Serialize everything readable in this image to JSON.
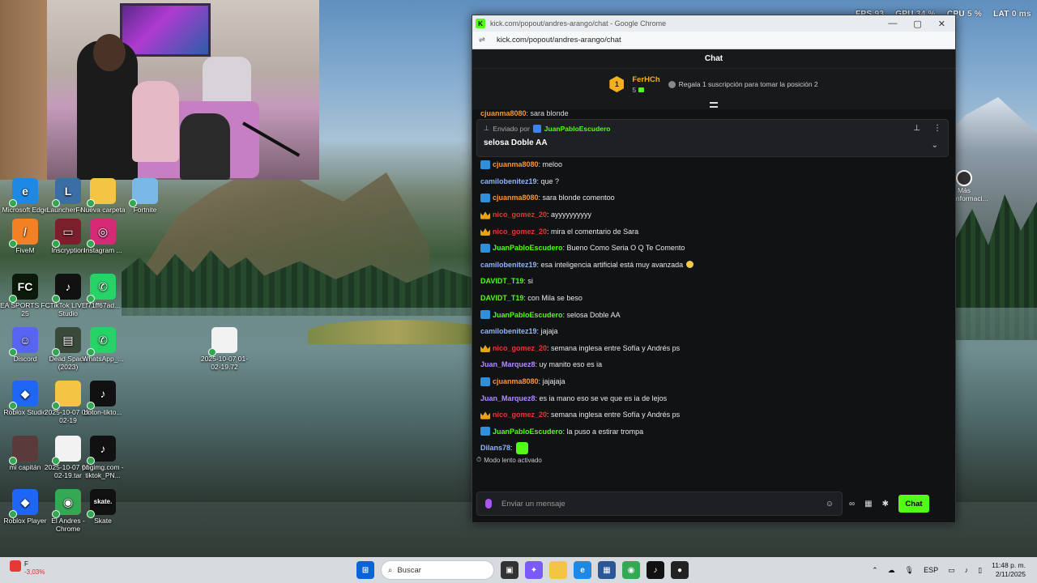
{
  "hud": {
    "fps_label": "FPS",
    "fps_value": "93",
    "gpu_label": "GPU",
    "gpu_value": "34 %",
    "cpu_label": "CPU",
    "cpu_value": "5 %",
    "lat_label": "LAT",
    "lat_value": "0 ms"
  },
  "desktop_icons": [
    {
      "label": "Microsoft Edge",
      "color": "#1e88e5",
      "glyph": "e"
    },
    {
      "label": "LauncherFe...",
      "color": "#3b6ea5",
      "glyph": "L"
    },
    {
      "label": "Nueva carpeta",
      "color": "#f4c542",
      "glyph": ""
    },
    {
      "label": "Fortnite",
      "color": "#7ab8e8",
      "glyph": ""
    },
    {
      "label": "FiveM",
      "color": "#f48024",
      "glyph": "/"
    },
    {
      "label": "Inscryption",
      "color": "#7a1f2b",
      "glyph": "▭"
    },
    {
      "label": "Instagram ...",
      "color": "#d62976",
      "glyph": "◎"
    },
    {
      "label": "EA SPORTS FC 25",
      "color": "#0b1a0b",
      "glyph": "FC"
    },
    {
      "label": "TikTok LIVE Studio",
      "color": "#111111",
      "glyph": "♪"
    },
    {
      "label": "f71ff67ad...",
      "color": "#25d366",
      "glyph": "✆"
    },
    {
      "label": "Discord",
      "color": "#5865f2",
      "glyph": "☺"
    },
    {
      "label": "Dead Space (2023)",
      "color": "#3a4a3a",
      "glyph": "▤"
    },
    {
      "label": "WhatsApp_...",
      "color": "#25d366",
      "glyph": "✆"
    },
    {
      "label": "2025-10-07 01-02-19.72",
      "color": "#f2f2f2",
      "glyph": ""
    },
    {
      "label": "Roblox Studio",
      "color": "#1e66f5",
      "glyph": "◆"
    },
    {
      "label": "2025-10-07 01-02-19",
      "color": "#f4c542",
      "glyph": ""
    },
    {
      "label": "boton-tikto...",
      "color": "#111111",
      "glyph": "♪"
    },
    {
      "label": "mi capitán",
      "color": "#5a3a3a",
      "glyph": ""
    },
    {
      "label": "2025-10-07 01-02-19.tar",
      "color": "#f2f2f2",
      "glyph": ""
    },
    {
      "label": "pngimg.com - tiktok_PN...",
      "color": "#111111",
      "glyph": "♪"
    },
    {
      "label": "Roblox Player",
      "color": "#1e66f5",
      "glyph": "◆"
    },
    {
      "label": "El Andres - Chrome",
      "color": "#34a853",
      "glyph": "◉"
    },
    {
      "label": "Skate",
      "color": "#111111",
      "glyph": "skate."
    }
  ],
  "right_icon": {
    "label": "Más informaci..."
  },
  "browser": {
    "title": "kick.com/popout/andres-arango/chat - Google Chrome",
    "url": "kick.com/popout/andres-arango/chat",
    "favicon": "K",
    "minimize": "—",
    "maximize": "▢",
    "close": "✕"
  },
  "chat": {
    "header": "Chat",
    "leader": {
      "rank": "1",
      "name": "FerHCh",
      "count": "5",
      "cta": "Regala 1 suscripción para tomar la posición 2"
    },
    "cut_user": "cjuanma8080",
    "cut_text": ": sara blonde",
    "pinned": {
      "prefix": "Enviado por",
      "user": "JuanPabloEscudero",
      "message": "selosa Doble AA",
      "pin_icon": "📌",
      "more_icon": "⋮",
      "expand_icon": "⌄"
    },
    "messages": [
      {
        "badge": "mod",
        "user": "cjuanma8080",
        "color": "#f49739",
        "text": ": meloo",
        "emote": ""
      },
      {
        "badge": "",
        "user": "camilobenitez19",
        "color": "#8fb4ff",
        "text": ": que ?",
        "emote": ""
      },
      {
        "badge": "mod",
        "user": "cjuanma8080",
        "color": "#f49739",
        "text": ": sara blonde comentoo",
        "emote": ""
      },
      {
        "badge": "crown",
        "user": "nico_gomez_20",
        "color": "#e53935",
        "text": ": ayyyyyyyyyy",
        "emote": ""
      },
      {
        "badge": "crown",
        "user": "nico_gomez_20",
        "color": "#e53935",
        "text": ": mira el comentario de Sara",
        "emote": ""
      },
      {
        "badge": "mod",
        "user": "JuanPabloEscudero",
        "color": "#53fc18",
        "text": ": Bueno Como Seria O Q Te Comento",
        "emote": ""
      },
      {
        "badge": "",
        "user": "camilobenitez19",
        "color": "#8fb4ff",
        "text": ": esa inteligencia artificial está muy avanzada",
        "emote": "sm"
      },
      {
        "badge": "",
        "user": "DAVIDT_T19",
        "color": "#53fc18",
        "text": ": si",
        "emote": ""
      },
      {
        "badge": "",
        "user": "DAVIDT_T19",
        "color": "#53fc18",
        "text": ": con Mila se beso",
        "emote": ""
      },
      {
        "badge": "mod",
        "user": "JuanPabloEscudero",
        "color": "#53fc18",
        "text": ": selosa Doble AA",
        "emote": ""
      },
      {
        "badge": "",
        "user": "camilobenitez19",
        "color": "#8fb4ff",
        "text": ": jajaja",
        "emote": ""
      },
      {
        "badge": "crown",
        "user": "nico_gomez_20",
        "color": "#e53935",
        "text": ": semana inglesa entre Sofía y Andrés ps",
        "emote": ""
      },
      {
        "badge": "",
        "user": "Juan_Marquez8",
        "color": "#b48cff",
        "text": ": uy manito eso es ia",
        "emote": ""
      },
      {
        "badge": "mod",
        "user": "cjuanma8080",
        "color": "#f49739",
        "text": ": jajajaja",
        "emote": ""
      },
      {
        "badge": "",
        "user": "Juan_Marquez8",
        "color": "#b48cff",
        "text": ": es ia mano eso se ve que es ia de lejos",
        "emote": ""
      },
      {
        "badge": "crown",
        "user": "nico_gomez_20",
        "color": "#e53935",
        "text": ": semana inglesa entre Sofía y Andrés ps",
        "emote": ""
      },
      {
        "badge": "mod",
        "user": "JuanPabloEscudero",
        "color": "#53fc18",
        "text": ": la puso a estirar trompa",
        "emote": ""
      },
      {
        "badge": "",
        "user": "Dilans78",
        "color": "#8fb4ff",
        "text": ":",
        "emote": "lg"
      }
    ],
    "slow_mode": "Modo lento activado",
    "composer_placeholder": "Enviar un mensaje",
    "send_label": "Chat",
    "tool_icons": {
      "emote": "☺",
      "link": "∞",
      "store": "▦",
      "settings": "✱"
    }
  },
  "taskbar": {
    "weather_temp": "F",
    "weather_change": "-3,03%",
    "search_placeholder": "Buscar",
    "lang": "ESP",
    "time": "11:48 p. m.",
    "date": "2/11/2025",
    "apps": [
      {
        "name": "windows-start",
        "color": "#0a64d8",
        "glyph": "⊞"
      },
      {
        "name": "task-view",
        "color": "#333333",
        "glyph": "▣"
      },
      {
        "name": "copilot",
        "color": "#7a5af8",
        "glyph": "✦"
      },
      {
        "name": "file-explorer",
        "color": "#f4c542",
        "glyph": ""
      },
      {
        "name": "edge",
        "color": "#1e88e5",
        "glyph": "e"
      },
      {
        "name": "store",
        "color": "#2b5797",
        "glyph": "▦"
      },
      {
        "name": "chrome",
        "color": "#34a853",
        "glyph": "◉"
      },
      {
        "name": "tiktok",
        "color": "#111111",
        "glyph": "♪"
      },
      {
        "name": "obs",
        "color": "#222222",
        "glyph": "●"
      }
    ]
  }
}
